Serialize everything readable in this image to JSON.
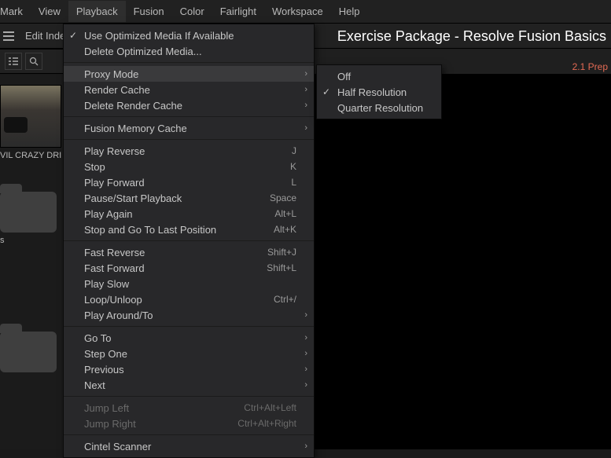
{
  "menubar": {
    "items": [
      "Mark",
      "View",
      "Playback",
      "Fusion",
      "Color",
      "Fairlight",
      "Workspace",
      "Help"
    ],
    "active_index": 2
  },
  "toolbar2": {
    "edit_index_label": "Edit Inde"
  },
  "header": {
    "title": "Exercise Package - Resolve Fusion Basics",
    "red_label": "2.1 Prep"
  },
  "media_pool": {
    "thumb_label": "VIL CRAZY DRIVI",
    "folder_label": "s"
  },
  "playback_menu": {
    "groups": [
      [
        {
          "label": "Use Optimized Media If Available",
          "checked": true
        },
        {
          "label": "Delete Optimized Media..."
        }
      ],
      [
        {
          "label": "Proxy Mode",
          "submenu": true,
          "hovered": true
        },
        {
          "label": "Render Cache",
          "submenu": true
        },
        {
          "label": "Delete Render Cache",
          "submenu": true
        }
      ],
      [
        {
          "label": "Fusion Memory Cache",
          "submenu": true
        }
      ],
      [
        {
          "label": "Play Reverse",
          "shortcut": "J"
        },
        {
          "label": "Stop",
          "shortcut": "K"
        },
        {
          "label": "Play Forward",
          "shortcut": "L"
        },
        {
          "label": "Pause/Start Playback",
          "shortcut": "Space"
        },
        {
          "label": "Play Again",
          "shortcut": "Alt+L"
        },
        {
          "label": "Stop and Go To Last Position",
          "shortcut": "Alt+K"
        }
      ],
      [
        {
          "label": "Fast Reverse",
          "shortcut": "Shift+J"
        },
        {
          "label": "Fast Forward",
          "shortcut": "Shift+L"
        },
        {
          "label": "Play Slow"
        },
        {
          "label": "Loop/Unloop",
          "shortcut": "Ctrl+/"
        },
        {
          "label": "Play Around/To",
          "submenu": true
        }
      ],
      [
        {
          "label": "Go To",
          "submenu": true
        },
        {
          "label": "Step One",
          "submenu": true
        },
        {
          "label": "Previous",
          "submenu": true
        },
        {
          "label": "Next",
          "submenu": true
        }
      ],
      [
        {
          "label": "Jump Left",
          "shortcut": "Ctrl+Alt+Left",
          "disabled": true
        },
        {
          "label": "Jump Right",
          "shortcut": "Ctrl+Alt+Right",
          "disabled": true
        }
      ],
      [
        {
          "label": "Cintel Scanner",
          "submenu": true
        }
      ]
    ]
  },
  "proxy_submenu": {
    "items": [
      {
        "label": "Off"
      },
      {
        "label": "Half Resolution",
        "checked": true
      },
      {
        "label": "Quarter Resolution"
      }
    ]
  }
}
